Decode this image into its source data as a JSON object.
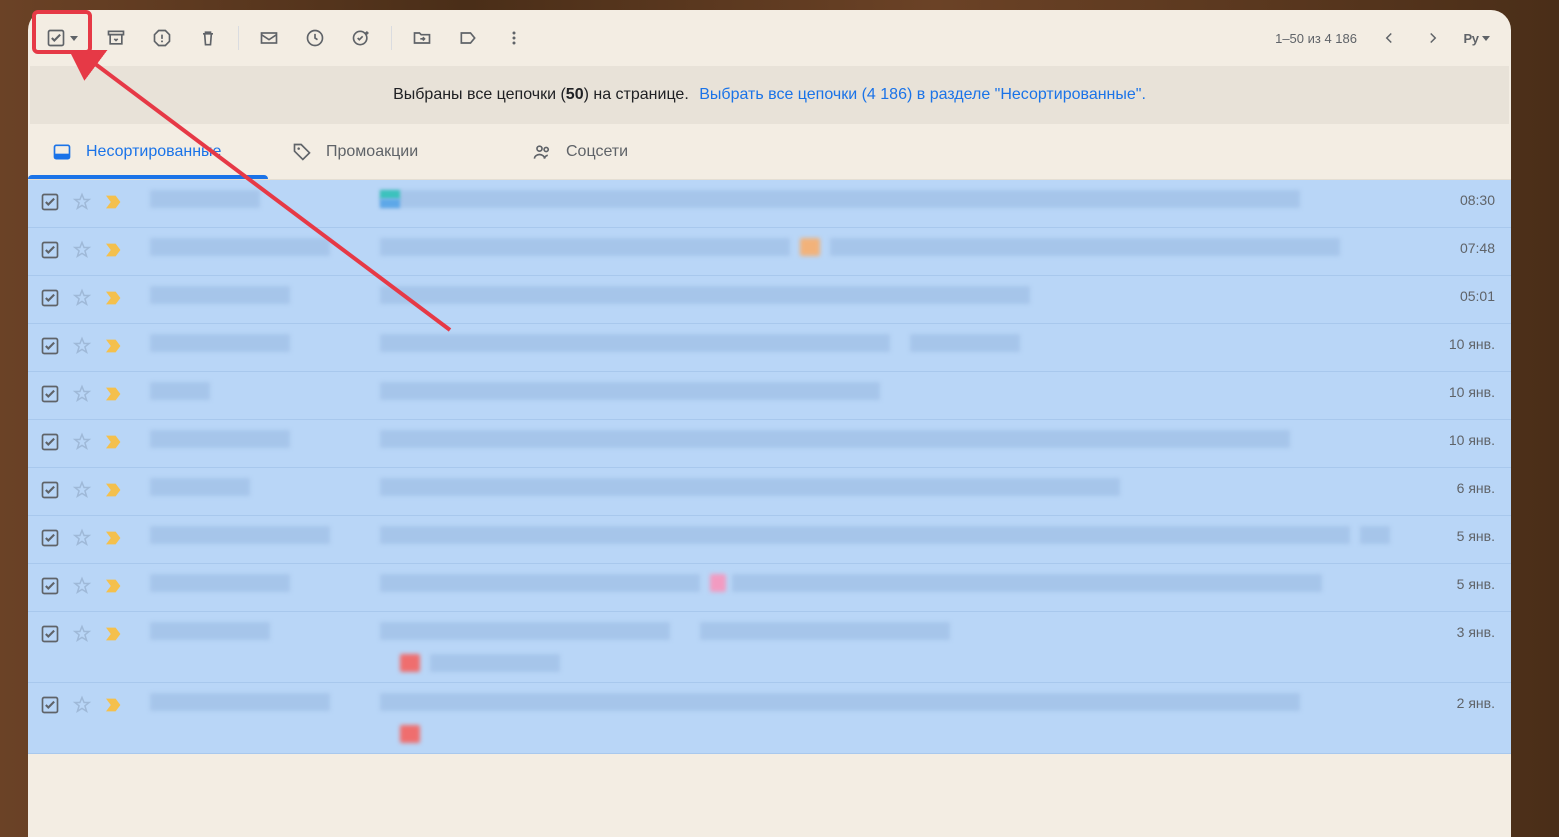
{
  "toolbar": {
    "pager_text": "1–50 из 4 186",
    "lang_label": "Рy"
  },
  "banner": {
    "text_a": "Выбраны все цепочки (",
    "text_bold": "50",
    "text_b": ") на странице.",
    "link": "Выбрать все цепочки (4 186) в разделе \"Несортированные\"."
  },
  "tabs": [
    {
      "label": "Несортированные"
    },
    {
      "label": "Промоакции"
    },
    {
      "label": "Соцсети"
    }
  ],
  "rows": [
    {
      "time": "08:30"
    },
    {
      "time": "07:48"
    },
    {
      "time": "05:01"
    },
    {
      "time": "10 янв."
    },
    {
      "time": "10 янв."
    },
    {
      "time": "10 янв."
    },
    {
      "time": "6 янв."
    },
    {
      "time": "5 янв."
    },
    {
      "time": "5 янв."
    },
    {
      "time": "3 янв."
    },
    {
      "time": "2 янв."
    }
  ]
}
